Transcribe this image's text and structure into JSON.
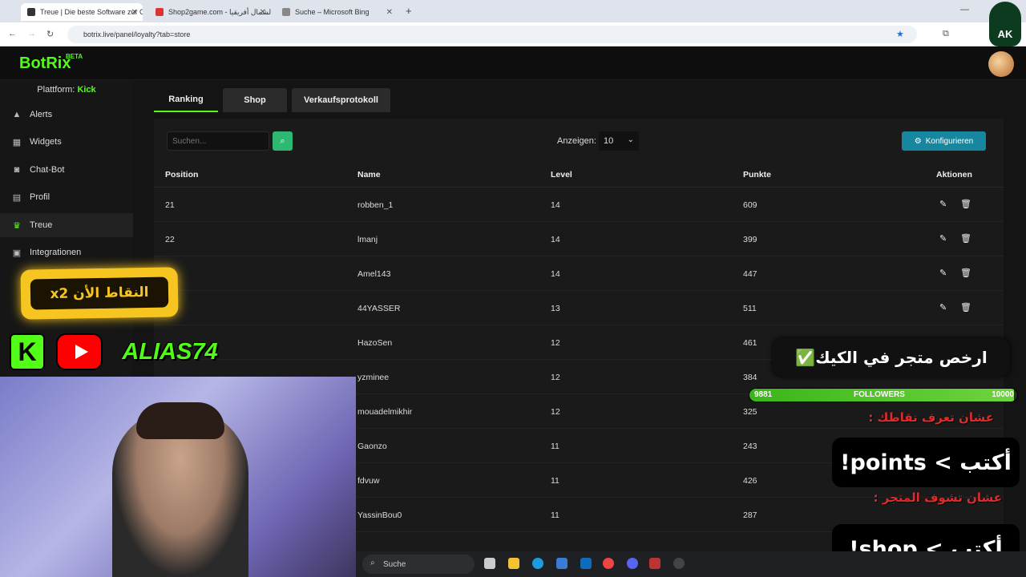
{
  "browser": {
    "tabs": [
      {
        "label": "Treue | Die beste Software zur C",
        "active": true
      },
      {
        "label": "Shop2game.com - الشمال أفريقيا",
        "active": false
      },
      {
        "label": "Suche – Microsoft Bing",
        "active": false
      }
    ],
    "url": "botrix.live/panel/loyalty?tab=store"
  },
  "app": {
    "logo": "BotRix",
    "beta": "BETA",
    "platform_label": "Plattform:",
    "platform_value": "Kick"
  },
  "sidebar": {
    "items": [
      {
        "label": "Alerts",
        "icon": "warning-icon"
      },
      {
        "label": "Widgets",
        "icon": "widgets-icon"
      },
      {
        "label": "Chat-Bot",
        "icon": "robot-icon"
      },
      {
        "label": "Profil",
        "icon": "id-card-icon"
      },
      {
        "label": "Treue",
        "icon": "trophy-icon",
        "active": true
      },
      {
        "label": "Integrationen",
        "icon": "integration-icon"
      }
    ]
  },
  "page": {
    "tabs": [
      "Ranking",
      "Shop",
      "Verkaufsprotokoll"
    ],
    "search_placeholder": "Suchen...",
    "show_label": "Anzeigen:",
    "show_value": "10",
    "config_label": "Konfigurieren"
  },
  "table": {
    "headers": [
      "Position",
      "Name",
      "Level",
      "Punkte",
      "Aktionen"
    ],
    "rows": [
      [
        "21",
        "robben_1",
        "14",
        "609"
      ],
      [
        "22",
        "lmanj",
        "14",
        "399"
      ],
      [
        "",
        "Amel143",
        "14",
        "447"
      ],
      [
        "",
        "44YASSER",
        "13",
        "511"
      ],
      [
        "",
        "HazoSen",
        "12",
        "461"
      ],
      [
        "",
        "yzminee",
        "12",
        "384"
      ],
      [
        "",
        "mouadelmikhir",
        "12",
        "325"
      ],
      [
        "",
        "Gaonzo",
        "11",
        "243"
      ],
      [
        "",
        "fdvuw",
        "11",
        "426"
      ],
      [
        "",
        "YassinBou0",
        "11",
        "287"
      ]
    ]
  },
  "overlay": {
    "points_badge": "النقاط الأن x2",
    "alias": "ALIAS74",
    "store_text": "ارخص متجر في الكيك✅",
    "followers_label": "FOLLOWERS",
    "followers_current": "9881",
    "followers_goal": "10000",
    "followers_progress": 0.9881,
    "know_points": "عشان تعرف نقاطك :",
    "cmd_points": "أكتب > points!",
    "see_shop": "عشان تشوف المتجر :",
    "cmd_shop": "أكتب > shop!",
    "channel_logo": "AK"
  },
  "taskbar": {
    "search": "Suche"
  },
  "colors": {
    "accent": "#53fc18",
    "config": "#1787a0",
    "search_btn": "#2eb872"
  }
}
